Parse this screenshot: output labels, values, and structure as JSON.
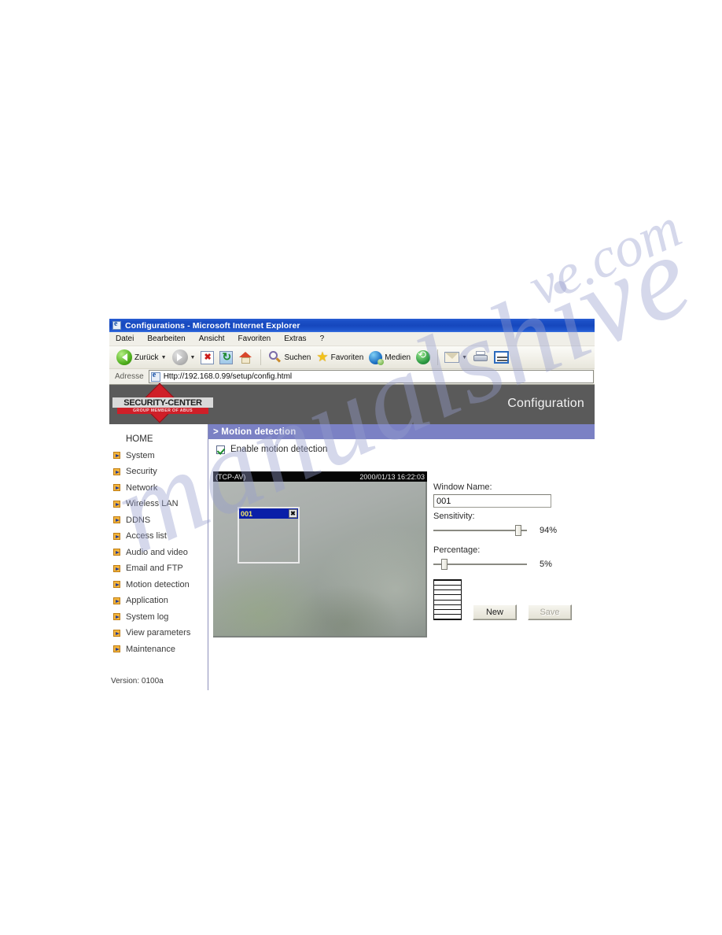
{
  "browser": {
    "title": "Configurations - Microsoft Internet Explorer",
    "ie_icon": "ie-logo-icon",
    "menu": [
      {
        "label": "Datei"
      },
      {
        "label": "Bearbeiten"
      },
      {
        "label": "Ansicht"
      },
      {
        "label": "Favoriten"
      },
      {
        "label": "Extras"
      },
      {
        "label": "?"
      }
    ],
    "toolbar": {
      "back_label": "Zurück",
      "back_icon": "back-arrow-icon",
      "forward_icon": "forward-arrow-icon",
      "stop_icon": "stop-icon",
      "refresh_icon": "refresh-icon",
      "home_icon": "home-icon",
      "search_label": "Suchen",
      "search_icon": "magnifier-icon",
      "favorites_label": "Favoriten",
      "favorites_icon": "star-icon",
      "media_label": "Medien",
      "media_icon": "globe-icon",
      "history_icon": "history-icon",
      "mail_icon": "mail-icon",
      "print_icon": "printer-icon",
      "edit_icon": "edit-page-icon"
    },
    "address": {
      "label": "Adresse",
      "url": "Http://192.168.0.99/setup/config.html",
      "icon": "page-icon"
    }
  },
  "brand": {
    "logo_main": "SECURITY-CENTER",
    "logo_sub": "GROUP MEMBER OF ABUS",
    "page_title": "Configuration",
    "bar_color": "#5a5a5a",
    "accent_color": "#cf1f28"
  },
  "sidebar": {
    "items": [
      {
        "label": "HOME",
        "bullet": false
      },
      {
        "label": "System",
        "bullet": true
      },
      {
        "label": "Security",
        "bullet": true
      },
      {
        "label": "Network",
        "bullet": true
      },
      {
        "label": "Wireless LAN",
        "bullet": true
      },
      {
        "label": "DDNS",
        "bullet": true
      },
      {
        "label": "Access list",
        "bullet": true
      },
      {
        "label": "Audio and video",
        "bullet": true
      },
      {
        "label": "Email and FTP",
        "bullet": true
      },
      {
        "label": "Motion detection",
        "bullet": true
      },
      {
        "label": "Application",
        "bullet": true
      },
      {
        "label": "System log",
        "bullet": true
      },
      {
        "label": "View parameters",
        "bullet": true
      },
      {
        "label": "Maintenance",
        "bullet": true
      }
    ],
    "version": "Version: 0100a"
  },
  "main": {
    "section_title": "> Motion detection",
    "section_color": "#7b81c4",
    "enable_label": "Enable motion detection",
    "enable_checked": true,
    "video": {
      "stream_label": "(TCP-AV)",
      "timestamp": "2000/01/13 16:22:03",
      "motion_window": {
        "name": "001",
        "close_glyph": "✖",
        "close_icon": "close-icon"
      }
    },
    "controls": {
      "window_name_label": "Window Name:",
      "window_name_value": "001",
      "sensitivity_label": "Sensitivity:",
      "sensitivity_value": "94%",
      "sensitivity_percent": 94,
      "percentage_label": "Percentage:",
      "percentage_value": "5%",
      "percentage_percent": 5,
      "new_button": "New",
      "save_button": "Save",
      "save_disabled": true,
      "histogram_rows": 9
    }
  },
  "watermark": {
    "text_main": "manualshive",
    "text_domain": "ve.com"
  }
}
